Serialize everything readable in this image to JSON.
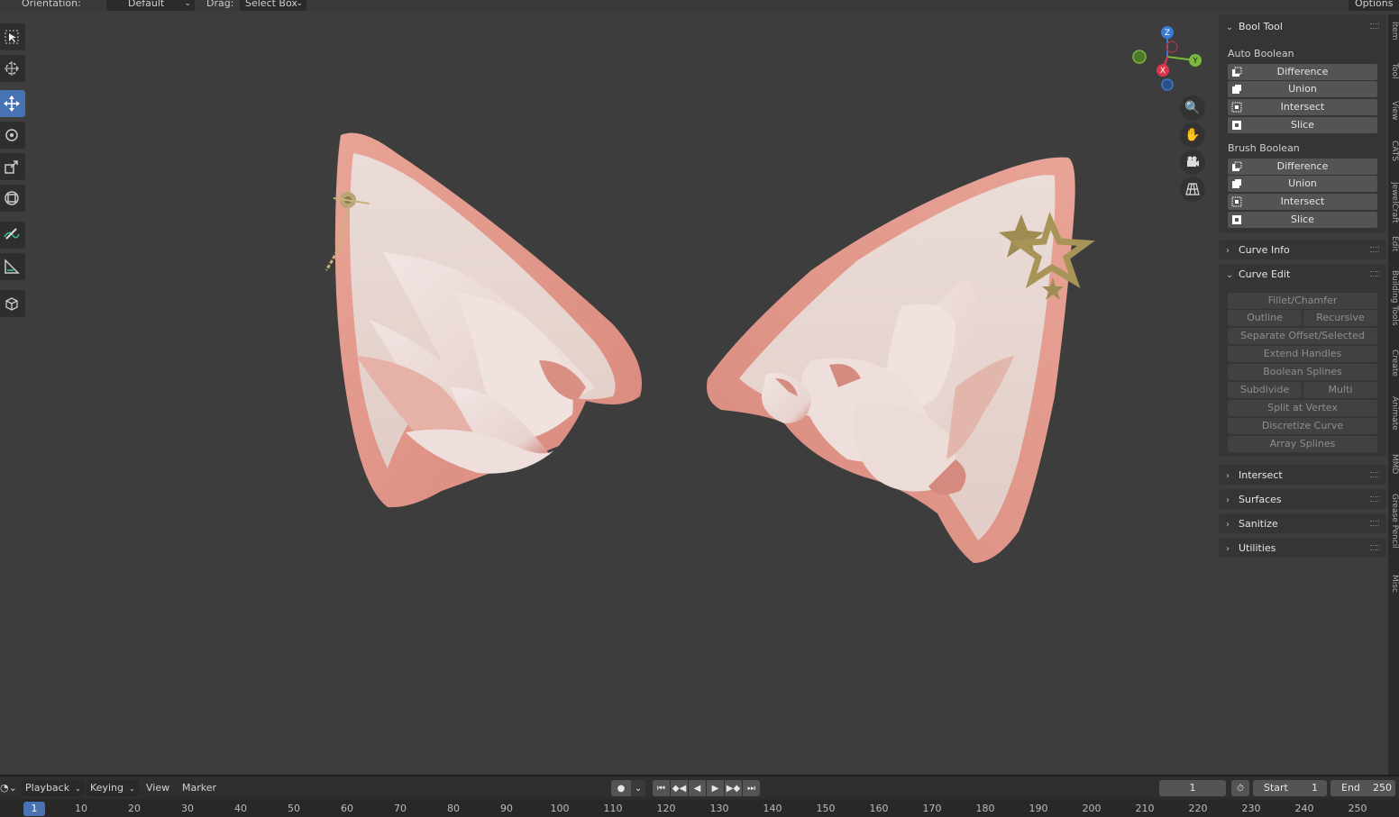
{
  "header": {
    "orientation_label": "Orientation:",
    "orientation_value": "Default",
    "drag_label": "Drag:",
    "drag_value": "Select Box",
    "options_label": "Options"
  },
  "toolbar": {
    "tools": [
      "select-box",
      "cursor",
      "move",
      "rotate",
      "scale",
      "transform",
      "annotate",
      "measure",
      "add-cube"
    ],
    "active": "move"
  },
  "sidebar": {
    "bool_tool": {
      "title": "Bool Tool",
      "auto_label": "Auto Boolean",
      "auto": [
        "Difference",
        "Union",
        "Intersect",
        "Slice"
      ],
      "brush_label": "Brush Boolean",
      "brush": [
        "Difference",
        "Union",
        "Intersect",
        "Slice"
      ]
    },
    "curve_info": "Curve Info",
    "curve_edit": {
      "title": "Curve Edit",
      "fillet": "Fillet/Chamfer",
      "outline": "Outline",
      "recursive_offset": "Recursive Offset",
      "separate_offset": "Separate Offset/Selected",
      "extend_handles": "Extend Handles",
      "boolean_splines": "Boolean Splines",
      "subdivide": "Subdivide",
      "multi_subdivide": "Multi Subdivide",
      "split_vertex": "Split at Vertex",
      "discretize": "Discretize Curve",
      "array_splines": "Array Splines"
    },
    "intersect": "Intersect",
    "surfaces": "Surfaces",
    "sanitize": "Sanitize",
    "utilities": "Utilities"
  },
  "side_tabs": [
    "Item",
    "Tool",
    "View",
    "CATS",
    "JewelCraft",
    "Edit",
    "Building Tools",
    "Create",
    "Animate",
    "MMD",
    "Grease Pencil",
    "Misc"
  ],
  "gizmo": {
    "z": "Z",
    "y": "Y",
    "x": "X"
  },
  "timeline": {
    "playback": "Playback",
    "keying": "Keying",
    "view": "View",
    "marker": "Marker",
    "current_frame": "1",
    "start_label": "Start",
    "start_value": "1",
    "end_label": "End",
    "end_value": "250",
    "ruler_current": "1",
    "ticks": [
      "10",
      "20",
      "30",
      "40",
      "50",
      "60",
      "70",
      "80",
      "90",
      "100",
      "110",
      "120",
      "130",
      "140",
      "150",
      "160",
      "170",
      "180",
      "190",
      "200",
      "210",
      "220",
      "230",
      "240",
      "250"
    ]
  },
  "colors": {
    "background": "#3d3d3d",
    "panel": "#353535",
    "button": "#545454",
    "accent": "#4772b3",
    "axis_x": "#e0364d",
    "axis_y": "#7ab93d",
    "axis_z": "#3b7bd8"
  }
}
